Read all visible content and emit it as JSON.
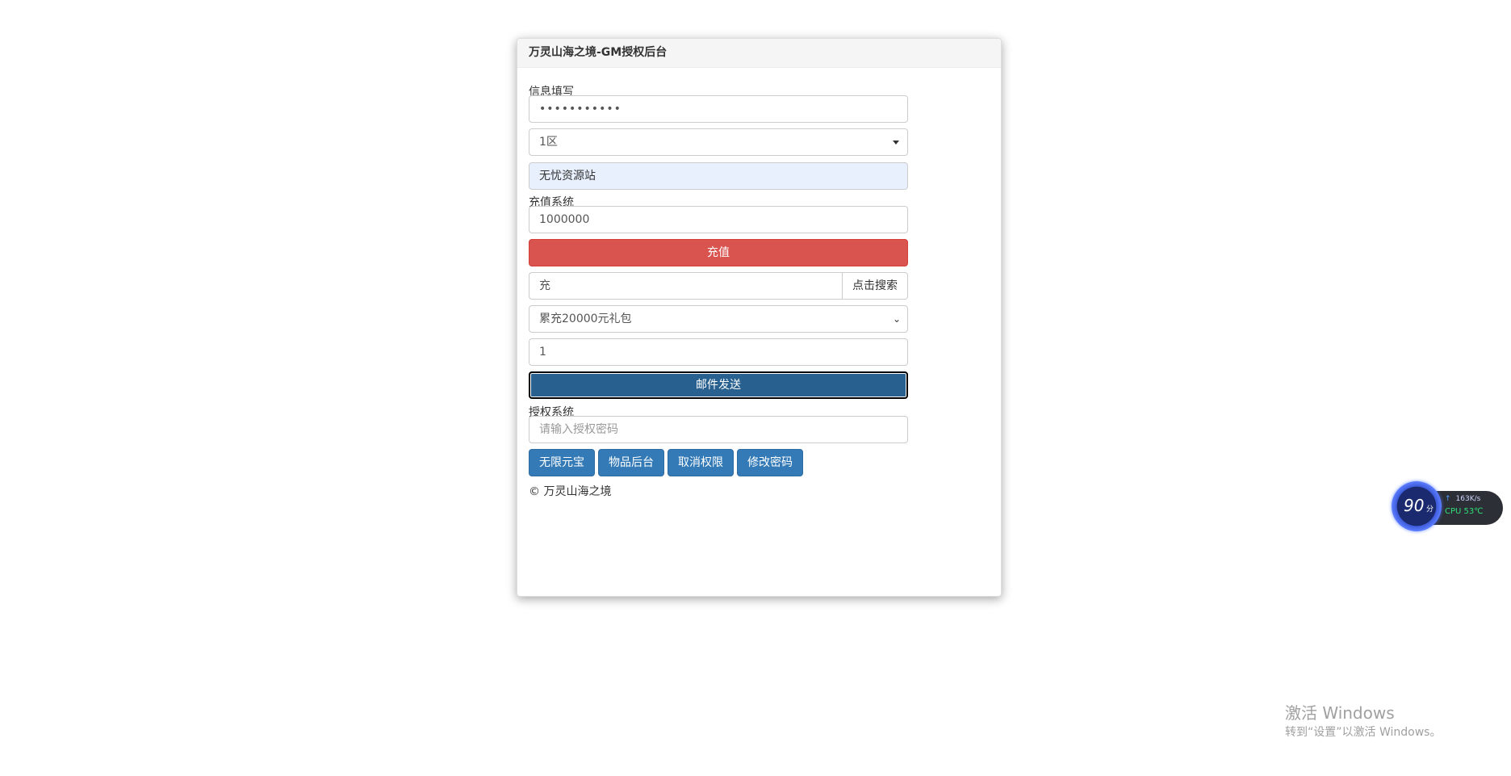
{
  "panel": {
    "title": "万灵山海之境-GM授权后台"
  },
  "info": {
    "label": "信息填写",
    "password_value": "•••••••••••",
    "server_selected": "1区",
    "role_value": "无忧资源站"
  },
  "recharge": {
    "label": "充值系统",
    "amount_value": "1000000",
    "button_label": "充值"
  },
  "search": {
    "input_value": "充",
    "button_label": "点击搜索"
  },
  "item": {
    "selected": "累充20000元礼包",
    "quantity_value": "1",
    "send_button_label": "邮件发送"
  },
  "auth": {
    "label": "授权系统",
    "placeholder": "请输入授权密码",
    "buttons": [
      "无限元宝",
      "物品后台",
      "取消权限",
      "修改密码"
    ]
  },
  "footer": {
    "text": "© 万灵山海之境"
  },
  "widget": {
    "score": "90",
    "score_unit": "分",
    "net_speed": "163K/s",
    "cpu": "CPU 53℃"
  },
  "watermark": {
    "line1": "激活 Windows",
    "line2": "转到“设置”以激活 Windows。"
  },
  "colors": {
    "danger": "#d9534f",
    "primary": "#337ab7",
    "primary_dark": "#286090",
    "autofill": "#e8f0fe"
  }
}
